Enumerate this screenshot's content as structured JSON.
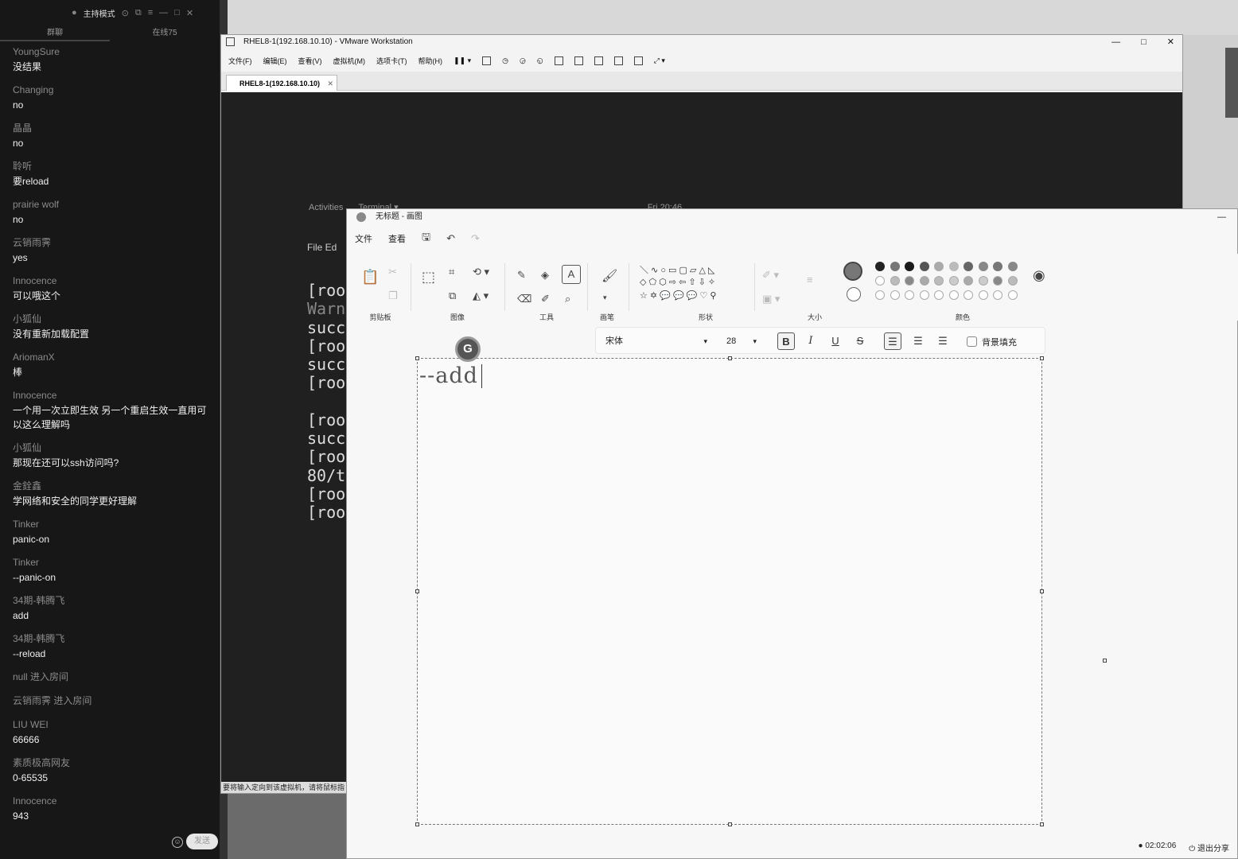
{
  "live_panel": {
    "mode_label": "主持模式",
    "tab_chat": "群聊",
    "tab_online": "在线75",
    "messages": [
      {
        "user": "YoungSure",
        "text": "没结果"
      },
      {
        "user": "Changing",
        "text": "no"
      },
      {
        "user": "晶晶",
        "text": "no"
      },
      {
        "user": "聆听",
        "text": "要reload"
      },
      {
        "user": "prairie wolf",
        "text": "no"
      },
      {
        "user": "云销雨霁",
        "text": "yes"
      },
      {
        "user": "Innocence",
        "text": "可以哦这个"
      },
      {
        "user": "小狐仙",
        "text": "没有重新加载配置"
      },
      {
        "user": "AriomanX",
        "text": "棒"
      },
      {
        "user": "Innocence",
        "text": "一个用一次立即生效 另一个重启生效一直用可以这么理解吗"
      },
      {
        "user": "小狐仙",
        "text": "那现在还可以ssh访问吗?"
      },
      {
        "user": "金銓鑫",
        "text": "学网络和安全的同学更好理解"
      },
      {
        "user": "Tinker",
        "text": "panic-on"
      },
      {
        "user": "Tinker",
        "text": "--panic-on"
      },
      {
        "user": "34期-韩腾飞",
        "text": "add"
      },
      {
        "user": "34期-韩腾飞",
        "text": "--reload"
      },
      {
        "system": "null 进入房间"
      },
      {
        "system": "云销雨霁 进入房间"
      },
      {
        "user": "LIU WEI",
        "text": "66666"
      },
      {
        "user": "素质极高网友",
        "text": "0-65535"
      },
      {
        "user": "Innocence",
        "text": "943"
      }
    ],
    "send_label": "发送"
  },
  "vmware": {
    "title": "RHEL8-1(192.168.10.10) - VMware Workstation",
    "menu": [
      "文件(F)",
      "编辑(E)",
      "查看(V)",
      "虚拟机(M)",
      "选项卡(T)",
      "帮助(H)"
    ],
    "tab_label": "RHEL8-1(192.168.10.10)",
    "gnome": {
      "activities": "Activities",
      "terminal": "Terminal ▾",
      "clock": "Fri 20:46"
    },
    "term_menu": "File  Ed",
    "terminal_lines": [
      "[roo",
      "Warn",
      "succ",
      "[roo",
      "succ",
      "[roo",
      "",
      "[roo",
      "succ",
      "[roo",
      "80/t",
      "[roo",
      "[roo"
    ],
    "status_text": "要将输入定向到该虚拟机，请将鼠标指"
  },
  "paint": {
    "title": "无标题 - 画图",
    "menu_file": "文件",
    "menu_view": "查看",
    "groups": [
      "剪贴板",
      "图像",
      "工具",
      "画笔",
      "形状",
      "大小",
      "颜色"
    ],
    "font_name": "宋体",
    "font_size": "28",
    "bg_fill_label": "背景填充",
    "canvas_text": "--add",
    "timer": "02:02:06",
    "exit_share": "退出分享"
  },
  "colors": {
    "palette_row1": [
      "#222222",
      "#777777",
      "#1a1a1a",
      "#555555",
      "#aaaaaa",
      "#bbbbbb",
      "#666666",
      "#888888",
      "#777777",
      "#888888"
    ],
    "palette_row2": [
      "#ffffff",
      "#bbbbbb",
      "#888888",
      "#aaaaaa",
      "#bbbbbb",
      "#cccccc",
      "#aaaaaa",
      "#cccccc",
      "#888888",
      "#bbbbbb"
    ]
  }
}
